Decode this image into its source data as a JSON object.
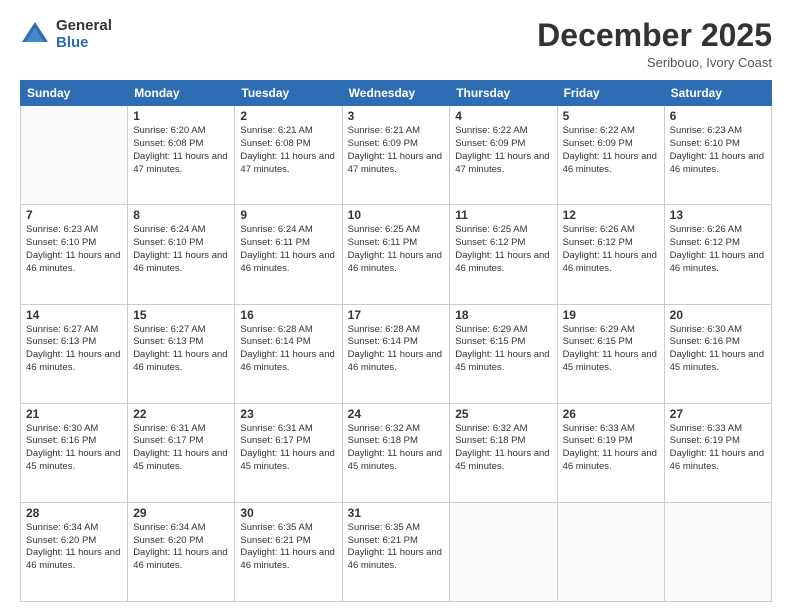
{
  "logo": {
    "general": "General",
    "blue": "Blue"
  },
  "title": "December 2025",
  "location": "Seribouo, Ivory Coast",
  "days_header": [
    "Sunday",
    "Monday",
    "Tuesday",
    "Wednesday",
    "Thursday",
    "Friday",
    "Saturday"
  ],
  "weeks": [
    [
      {
        "day": "",
        "sunrise": "",
        "sunset": "",
        "daylight": ""
      },
      {
        "day": "1",
        "sunrise": "Sunrise: 6:20 AM",
        "sunset": "Sunset: 6:08 PM",
        "daylight": "Daylight: 11 hours and 47 minutes."
      },
      {
        "day": "2",
        "sunrise": "Sunrise: 6:21 AM",
        "sunset": "Sunset: 6:08 PM",
        "daylight": "Daylight: 11 hours and 47 minutes."
      },
      {
        "day": "3",
        "sunrise": "Sunrise: 6:21 AM",
        "sunset": "Sunset: 6:09 PM",
        "daylight": "Daylight: 11 hours and 47 minutes."
      },
      {
        "day": "4",
        "sunrise": "Sunrise: 6:22 AM",
        "sunset": "Sunset: 6:09 PM",
        "daylight": "Daylight: 11 hours and 47 minutes."
      },
      {
        "day": "5",
        "sunrise": "Sunrise: 6:22 AM",
        "sunset": "Sunset: 6:09 PM",
        "daylight": "Daylight: 11 hours and 46 minutes."
      },
      {
        "day": "6",
        "sunrise": "Sunrise: 6:23 AM",
        "sunset": "Sunset: 6:10 PM",
        "daylight": "Daylight: 11 hours and 46 minutes."
      }
    ],
    [
      {
        "day": "7",
        "sunrise": "Sunrise: 6:23 AM",
        "sunset": "Sunset: 6:10 PM",
        "daylight": "Daylight: 11 hours and 46 minutes."
      },
      {
        "day": "8",
        "sunrise": "Sunrise: 6:24 AM",
        "sunset": "Sunset: 6:10 PM",
        "daylight": "Daylight: 11 hours and 46 minutes."
      },
      {
        "day": "9",
        "sunrise": "Sunrise: 6:24 AM",
        "sunset": "Sunset: 6:11 PM",
        "daylight": "Daylight: 11 hours and 46 minutes."
      },
      {
        "day": "10",
        "sunrise": "Sunrise: 6:25 AM",
        "sunset": "Sunset: 6:11 PM",
        "daylight": "Daylight: 11 hours and 46 minutes."
      },
      {
        "day": "11",
        "sunrise": "Sunrise: 6:25 AM",
        "sunset": "Sunset: 6:12 PM",
        "daylight": "Daylight: 11 hours and 46 minutes."
      },
      {
        "day": "12",
        "sunrise": "Sunrise: 6:26 AM",
        "sunset": "Sunset: 6:12 PM",
        "daylight": "Daylight: 11 hours and 46 minutes."
      },
      {
        "day": "13",
        "sunrise": "Sunrise: 6:26 AM",
        "sunset": "Sunset: 6:12 PM",
        "daylight": "Daylight: 11 hours and 46 minutes."
      }
    ],
    [
      {
        "day": "14",
        "sunrise": "Sunrise: 6:27 AM",
        "sunset": "Sunset: 6:13 PM",
        "daylight": "Daylight: 11 hours and 46 minutes."
      },
      {
        "day": "15",
        "sunrise": "Sunrise: 6:27 AM",
        "sunset": "Sunset: 6:13 PM",
        "daylight": "Daylight: 11 hours and 46 minutes."
      },
      {
        "day": "16",
        "sunrise": "Sunrise: 6:28 AM",
        "sunset": "Sunset: 6:14 PM",
        "daylight": "Daylight: 11 hours and 46 minutes."
      },
      {
        "day": "17",
        "sunrise": "Sunrise: 6:28 AM",
        "sunset": "Sunset: 6:14 PM",
        "daylight": "Daylight: 11 hours and 46 minutes."
      },
      {
        "day": "18",
        "sunrise": "Sunrise: 6:29 AM",
        "sunset": "Sunset: 6:15 PM",
        "daylight": "Daylight: 11 hours and 45 minutes."
      },
      {
        "day": "19",
        "sunrise": "Sunrise: 6:29 AM",
        "sunset": "Sunset: 6:15 PM",
        "daylight": "Daylight: 11 hours and 45 minutes."
      },
      {
        "day": "20",
        "sunrise": "Sunrise: 6:30 AM",
        "sunset": "Sunset: 6:16 PM",
        "daylight": "Daylight: 11 hours and 45 minutes."
      }
    ],
    [
      {
        "day": "21",
        "sunrise": "Sunrise: 6:30 AM",
        "sunset": "Sunset: 6:16 PM",
        "daylight": "Daylight: 11 hours and 45 minutes."
      },
      {
        "day": "22",
        "sunrise": "Sunrise: 6:31 AM",
        "sunset": "Sunset: 6:17 PM",
        "daylight": "Daylight: 11 hours and 45 minutes."
      },
      {
        "day": "23",
        "sunrise": "Sunrise: 6:31 AM",
        "sunset": "Sunset: 6:17 PM",
        "daylight": "Daylight: 11 hours and 45 minutes."
      },
      {
        "day": "24",
        "sunrise": "Sunrise: 6:32 AM",
        "sunset": "Sunset: 6:18 PM",
        "daylight": "Daylight: 11 hours and 45 minutes."
      },
      {
        "day": "25",
        "sunrise": "Sunrise: 6:32 AM",
        "sunset": "Sunset: 6:18 PM",
        "daylight": "Daylight: 11 hours and 45 minutes."
      },
      {
        "day": "26",
        "sunrise": "Sunrise: 6:33 AM",
        "sunset": "Sunset: 6:19 PM",
        "daylight": "Daylight: 11 hours and 46 minutes."
      },
      {
        "day": "27",
        "sunrise": "Sunrise: 6:33 AM",
        "sunset": "Sunset: 6:19 PM",
        "daylight": "Daylight: 11 hours and 46 minutes."
      }
    ],
    [
      {
        "day": "28",
        "sunrise": "Sunrise: 6:34 AM",
        "sunset": "Sunset: 6:20 PM",
        "daylight": "Daylight: 11 hours and 46 minutes."
      },
      {
        "day": "29",
        "sunrise": "Sunrise: 6:34 AM",
        "sunset": "Sunset: 6:20 PM",
        "daylight": "Daylight: 11 hours and 46 minutes."
      },
      {
        "day": "30",
        "sunrise": "Sunrise: 6:35 AM",
        "sunset": "Sunset: 6:21 PM",
        "daylight": "Daylight: 11 hours and 46 minutes."
      },
      {
        "day": "31",
        "sunrise": "Sunrise: 6:35 AM",
        "sunset": "Sunset: 6:21 PM",
        "daylight": "Daylight: 11 hours and 46 minutes."
      },
      {
        "day": "",
        "sunrise": "",
        "sunset": "",
        "daylight": ""
      },
      {
        "day": "",
        "sunrise": "",
        "sunset": "",
        "daylight": ""
      },
      {
        "day": "",
        "sunrise": "",
        "sunset": "",
        "daylight": ""
      }
    ]
  ]
}
